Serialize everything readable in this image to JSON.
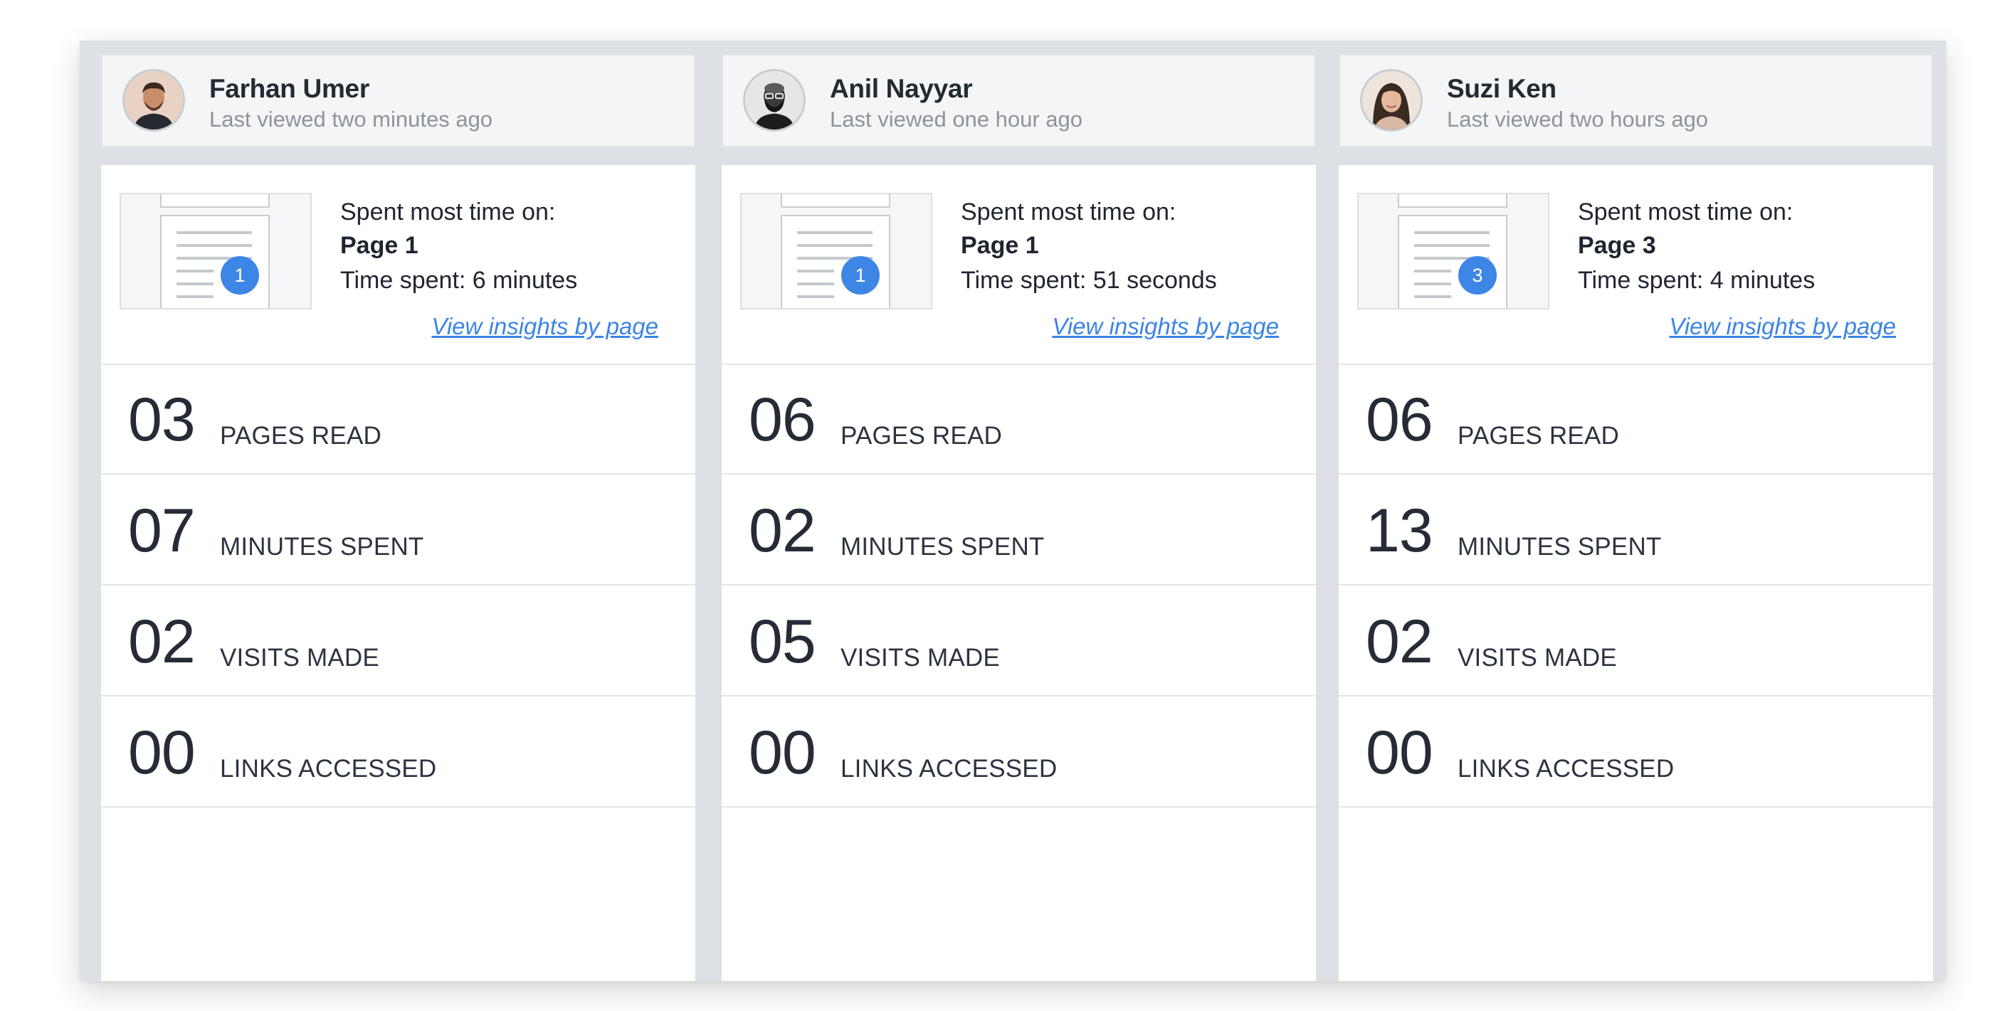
{
  "cards": [
    {
      "user": {
        "name": "Farhan Umer",
        "last_viewed": "Last viewed two minutes ago"
      },
      "insight": {
        "page_number": "1",
        "spent_label": "Spent most time on:",
        "page": "Page 1",
        "time_spent": "Time spent: 6 minutes",
        "link": "View insights by page"
      },
      "stats": [
        {
          "value": "03",
          "label": "PAGES READ"
        },
        {
          "value": "07",
          "label": "MINUTES SPENT"
        },
        {
          "value": "02",
          "label": "VISITS MADE"
        },
        {
          "value": "00",
          "label": "LINKS ACCESSED"
        }
      ]
    },
    {
      "user": {
        "name": "Anil Nayyar",
        "last_viewed": "Last viewed one hour ago"
      },
      "insight": {
        "page_number": "1",
        "spent_label": "Spent most time on:",
        "page": "Page 1",
        "time_spent": "Time spent: 51 seconds",
        "link": "View insights by page"
      },
      "stats": [
        {
          "value": "06",
          "label": "PAGES READ"
        },
        {
          "value": "02",
          "label": "MINUTES SPENT"
        },
        {
          "value": "05",
          "label": "VISITS MADE"
        },
        {
          "value": "00",
          "label": "LINKS ACCESSED"
        }
      ]
    },
    {
      "user": {
        "name": "Suzi Ken",
        "last_viewed": "Last viewed two hours ago"
      },
      "insight": {
        "page_number": "3",
        "spent_label": "Spent most time on:",
        "page": "Page 3",
        "time_spent": "Time spent: 4 minutes",
        "link": "View insights by page"
      },
      "stats": [
        {
          "value": "06",
          "label": "PAGES READ"
        },
        {
          "value": "13",
          "label": "MINUTES SPENT"
        },
        {
          "value": "02",
          "label": "VISITS MADE"
        },
        {
          "value": "00",
          "label": "LINKS ACCESSED"
        }
      ]
    }
  ],
  "colors": {
    "accent": "#3d86e6",
    "link": "#3c85e3",
    "board_background": "#dde1e5",
    "header_background": "#f4f5f6"
  }
}
